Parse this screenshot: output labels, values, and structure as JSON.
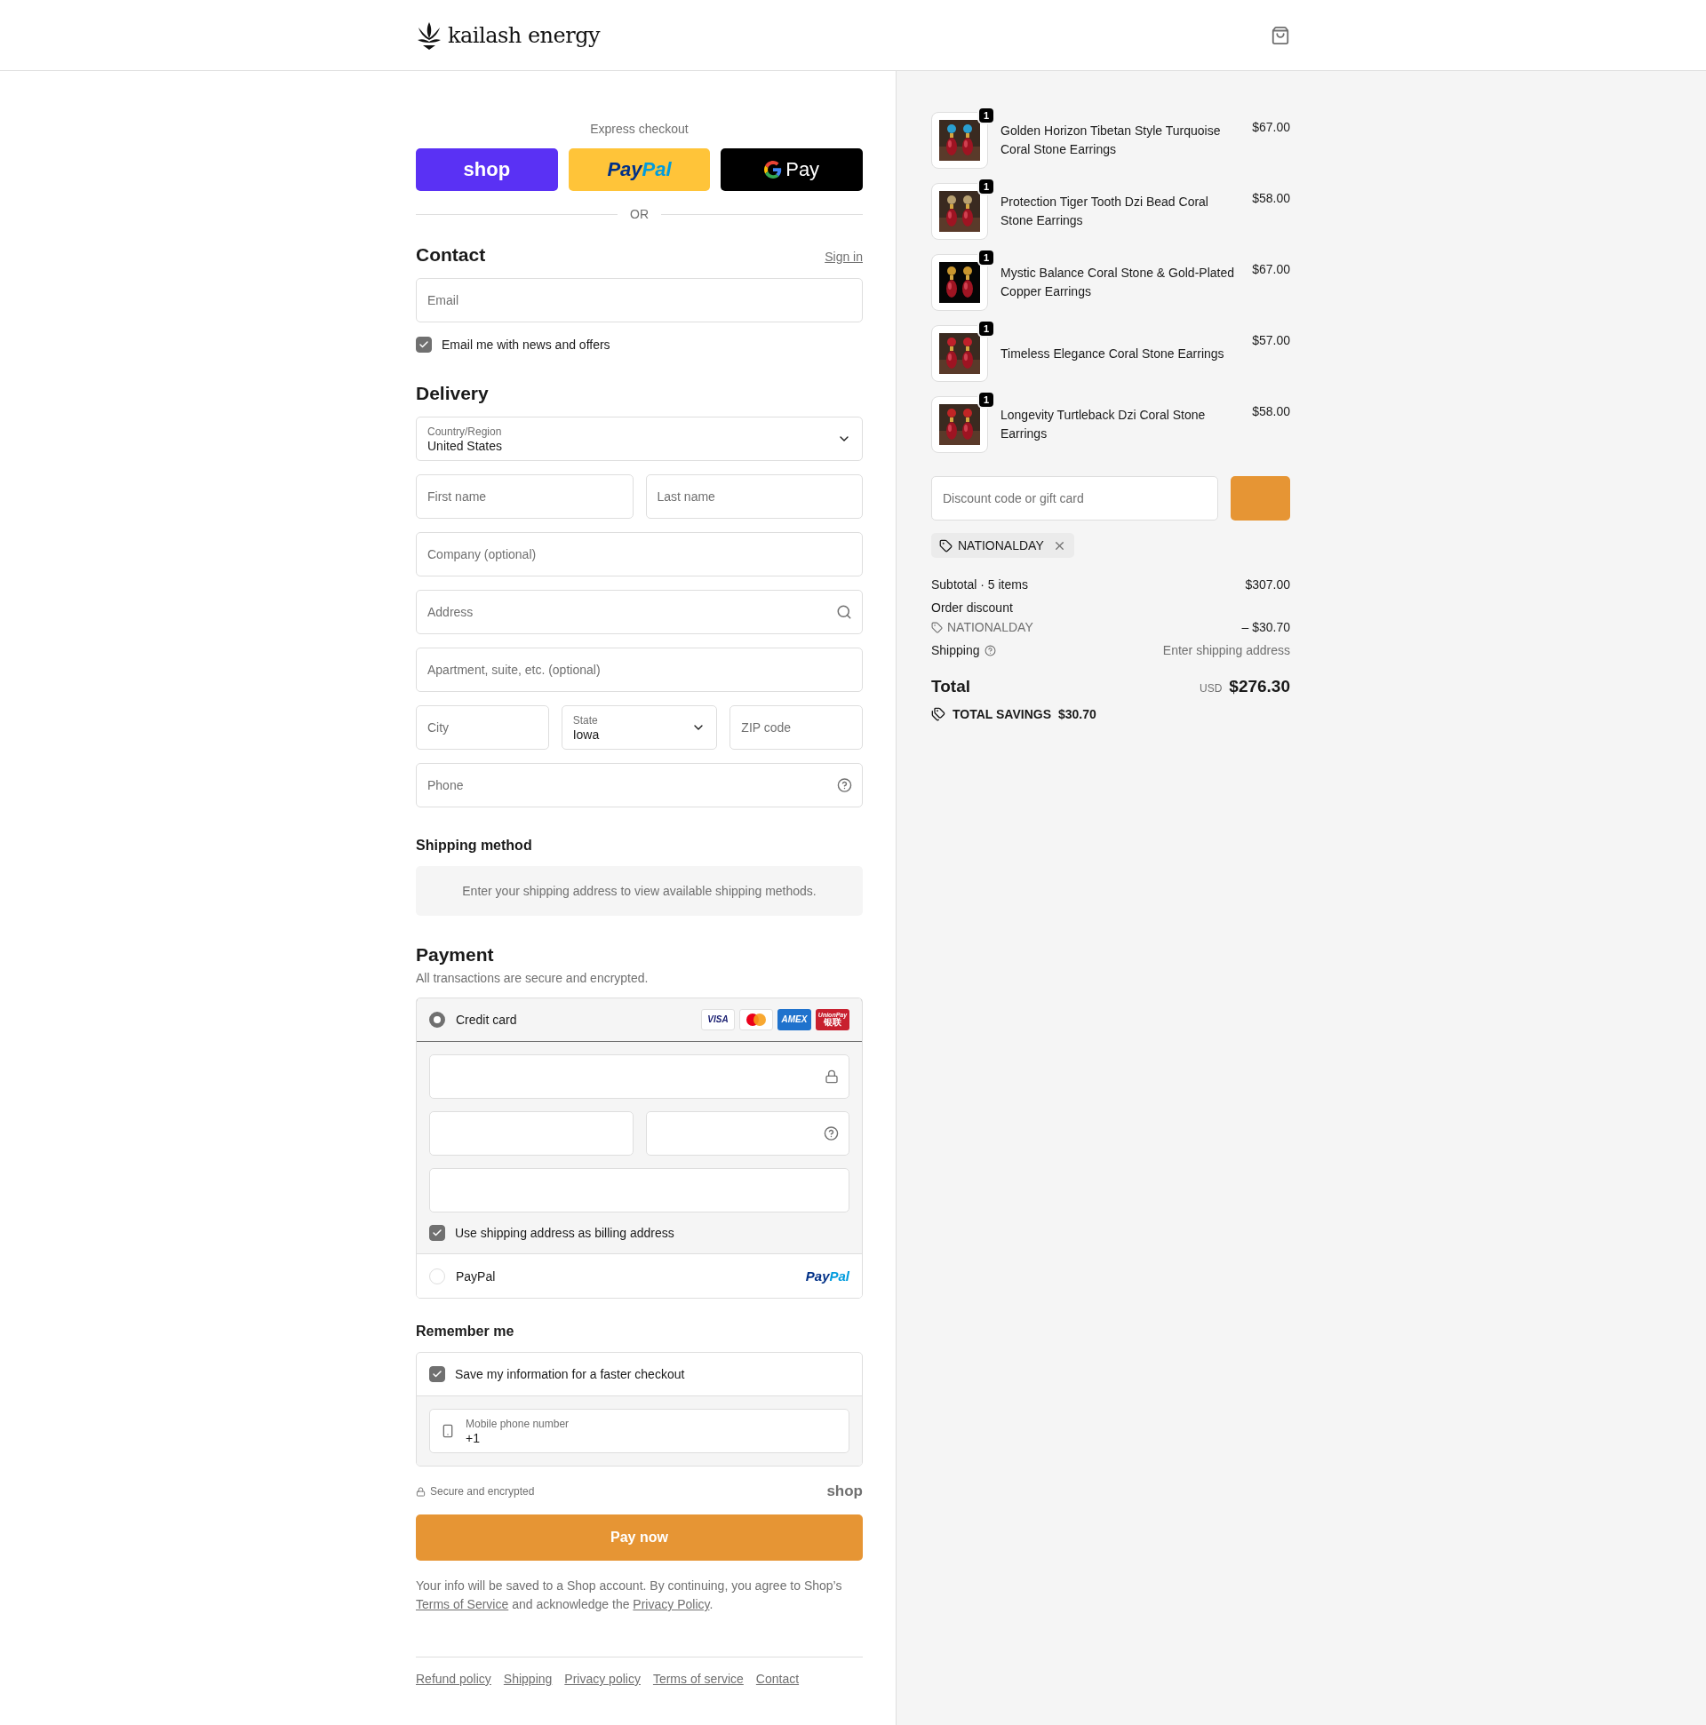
{
  "header": {
    "logo": "kailash energy"
  },
  "express": {
    "title": "Express checkout",
    "buttons": [
      {
        "kind": "shop",
        "parts": [
          "shop"
        ]
      },
      {
        "kind": "paypal",
        "parts": [
          "Pay",
          "Pal"
        ]
      },
      {
        "kind": "gpay",
        "parts": [
          "Pay"
        ]
      }
    ],
    "divider": "OR"
  },
  "contact": {
    "title": "Contact",
    "sign_in": "Sign in",
    "email": {
      "placeholder": "Email"
    },
    "newsletter": {
      "label": "Email me with news and offers",
      "checked": true
    }
  },
  "delivery": {
    "title": "Delivery",
    "rows": [
      [
        {
          "kind": "select",
          "label": "Country/Region",
          "value": "United States"
        }
      ],
      [
        {
          "kind": "input",
          "placeholder": "First name"
        },
        {
          "kind": "input",
          "placeholder": "Last name"
        }
      ],
      [
        {
          "kind": "input",
          "placeholder": "Company (optional)"
        }
      ],
      [
        {
          "kind": "input",
          "placeholder": "Address"
        }
      ],
      [
        {
          "kind": "input",
          "placeholder": "Apartment, suite, etc. (optional)"
        }
      ],
      [
        {
          "kind": "input",
          "placeholder": "City"
        },
        {
          "kind": "select",
          "label": "State",
          "value": "Iowa"
        },
        {
          "kind": "input",
          "placeholder": "ZIP code"
        }
      ],
      [
        {
          "kind": "input",
          "placeholder": "Phone"
        }
      ]
    ]
  },
  "shipping_method": {
    "title": "Shipping method",
    "message": "Enter your shipping address to view available shipping methods."
  },
  "payment": {
    "title": "Payment",
    "subtitle": "All transactions are secure and encrypted.",
    "methods": [
      {
        "kind": "card",
        "label": "Credit card",
        "selected": true,
        "brands": [
          {
            "kind": "visa",
            "label": "VISA"
          },
          {
            "kind": "mastercard"
          },
          {
            "kind": "amex",
            "label": "AMEX"
          },
          {
            "kind": "unionpay",
            "label": "UnionPay",
            "sublabel": "银联"
          }
        ],
        "billing": {
          "label": "Use shipping address as billing address",
          "checked": true
        }
      },
      {
        "kind": "paypal",
        "label": "PayPal",
        "selected": false,
        "logo": [
          "Pay",
          "Pal"
        ]
      }
    ]
  },
  "remember": {
    "title": "Remember me",
    "save": {
      "label": "Save my information for a faster checkout",
      "checked": true
    },
    "phone": {
      "label": "Mobile phone number",
      "value": "+1"
    }
  },
  "secure": {
    "label": "Secure and encrypted",
    "brand": "shop"
  },
  "pay_button": "Pay now",
  "legal": [
    {
      "text": "Your info will be saved to a Shop account. By continuing, you agree to Shop’s "
    },
    {
      "link": "Terms of Service"
    },
    {
      "text": " and acknowledge the "
    },
    {
      "link": "Privacy Policy"
    },
    {
      "text": "."
    }
  ],
  "footer_links": [
    "Refund policy",
    "Shipping",
    "Privacy policy",
    "Terms of service",
    "Contact"
  ],
  "summary": {
    "items": [
      {
        "name": "Golden Horizon Tibetan Style Turquoise Coral Stone Earrings",
        "price": "$67.00",
        "quantity": "1"
      },
      {
        "name": "Protection Tiger Tooth Dzi Bead Coral Stone Earrings",
        "price": "$58.00",
        "quantity": "1"
      },
      {
        "name": "Mystic Balance Coral Stone & Gold-Plated Copper Earrings",
        "price": "$67.00",
        "quantity": "1"
      },
      {
        "name": "Timeless Elegance Coral Stone Earrings",
        "price": "$57.00",
        "quantity": "1"
      },
      {
        "name": "Longevity Turtleback Dzi Coral Stone Earrings",
        "price": "$58.00",
        "quantity": "1"
      }
    ],
    "discount": {
      "placeholder": "Discount code or gift card"
    },
    "applied_code": "NATIONALDAY",
    "subtotal": {
      "label": "Subtotal · 5 items",
      "value": "$307.00"
    },
    "order_discount": {
      "label": "Order discount",
      "code": "NATIONALDAY",
      "value": "– $30.70"
    },
    "shipping": {
      "label": "Shipping",
      "value": "Enter shipping address"
    },
    "total": {
      "label": "Total",
      "currency": "USD",
      "value": "$276.30"
    },
    "savings": {
      "label": "TOTAL SAVINGS",
      "value": "$30.70"
    }
  }
}
